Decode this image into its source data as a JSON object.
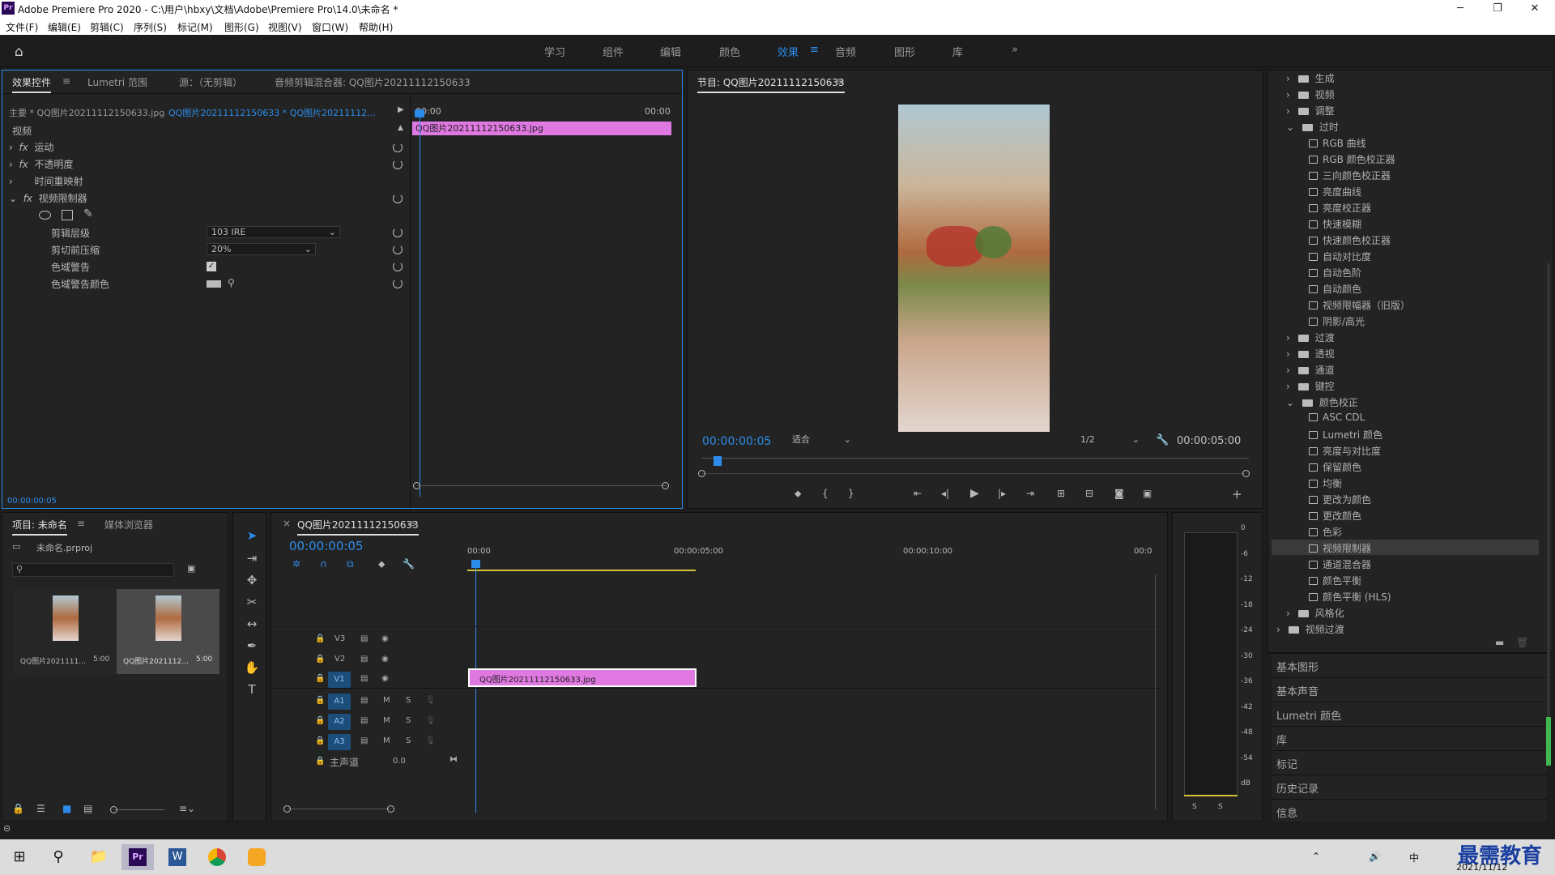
{
  "window": {
    "title": "Adobe Premiere Pro 2020 - C:\\用户\\hbxy\\文档\\Adobe\\Premiere Pro\\14.0\\未命名 *",
    "app_badge": "Pr"
  },
  "menu": [
    "文件(F)",
    "编辑(E)",
    "剪辑(C)",
    "序列(S)",
    "标记(M)",
    "图形(G)",
    "视图(V)",
    "窗口(W)",
    "帮助(H)"
  ],
  "workspaces": [
    "学习",
    "组件",
    "编辑",
    "颜色",
    "效果",
    "音频",
    "图形",
    "库"
  ],
  "effect_controls": {
    "tabs": [
      "效果控件",
      "Lumetri 范围",
      "源：（无剪辑）",
      "音频剪辑混合器: QQ图片20211112150633"
    ],
    "master": "主要 * QQ图片20211112150633.jpg",
    "sequence_clip": "QQ图片20211112150633 * QQ图片20211112...",
    "time_start": "00:00",
    "time_end": "00:00",
    "clip_name": "QQ图片20211112150633.jpg",
    "section": "视频",
    "effects": [
      "运动",
      "不透明度",
      "时间重映射",
      "视频限制器"
    ],
    "params": [
      {
        "label": "剪辑层级",
        "value": "103 IRE"
      },
      {
        "label": "剪切前压缩",
        "value": "20%"
      },
      {
        "label": "色域警告",
        "value": ""
      },
      {
        "label": "色域警告颜色",
        "value": ""
      }
    ],
    "timecode": "00:00:00:05"
  },
  "program": {
    "title": "节目: QQ图片20211112150633",
    "timecode": "00:00:00:05",
    "fit": "适合",
    "resolution": "1/2",
    "duration": "00:00:05:00"
  },
  "project": {
    "tabs": [
      "项目: 未命名",
      "媒体浏览器"
    ],
    "file": "未命名.prproj",
    "items": [
      {
        "name": "QQ图片2021111...",
        "dur": "5:00"
      },
      {
        "name": "QQ图片2021112...",
        "dur": "5:00"
      }
    ]
  },
  "timeline": {
    "title": "QQ图片20211112150633",
    "timecode": "00:00:00:05",
    "ruler": [
      "00:00",
      "00:00:05:00",
      "00:00:10:00",
      "00:0"
    ],
    "video_tracks": [
      "V3",
      "V2",
      "V1"
    ],
    "audio_tracks": [
      "A1",
      "A2",
      "A3"
    ],
    "master_label": "主声道",
    "master_value": "0.0",
    "clip": "QQ图片20211112150633.jpg",
    "m": "M",
    "s": "S"
  },
  "meter": {
    "scale": [
      "0",
      "-6",
      "-12",
      "-18",
      "-24",
      "-30",
      "-36",
      "-42",
      "-48",
      "-54",
      "dB"
    ],
    "solo": [
      "S",
      "S"
    ]
  },
  "effects_panel": {
    "tree": [
      {
        "label": "生成",
        "type": "folder",
        "indent": 0
      },
      {
        "label": "视频",
        "type": "folder",
        "indent": 0
      },
      {
        "label": "调整",
        "type": "folder",
        "indent": 0
      },
      {
        "label": "过时",
        "type": "folder",
        "indent": 0,
        "open": true
      },
      {
        "label": "RGB 曲线",
        "type": "fx",
        "indent": 1
      },
      {
        "label": "RGB 颜色校正器",
        "type": "fx",
        "indent": 1
      },
      {
        "label": "三向颜色校正器",
        "type": "fx",
        "indent": 1
      },
      {
        "label": "亮度曲线",
        "type": "fx",
        "indent": 1
      },
      {
        "label": "亮度校正器",
        "type": "fx",
        "indent": 1
      },
      {
        "label": "快速模糊",
        "type": "fx",
        "indent": 1
      },
      {
        "label": "快速颜色校正器",
        "type": "fx",
        "indent": 1
      },
      {
        "label": "自动对比度",
        "type": "fx",
        "indent": 1
      },
      {
        "label": "自动色阶",
        "type": "fx",
        "indent": 1
      },
      {
        "label": "自动颜色",
        "type": "fx",
        "indent": 1
      },
      {
        "label": "视频限幅器（旧版）",
        "type": "fx",
        "indent": 1
      },
      {
        "label": "阴影/高光",
        "type": "fx",
        "indent": 1
      },
      {
        "label": "过渡",
        "type": "folder",
        "indent": 0
      },
      {
        "label": "透视",
        "type": "folder",
        "indent": 0
      },
      {
        "label": "通道",
        "type": "folder",
        "indent": 0
      },
      {
        "label": "键控",
        "type": "folder",
        "indent": 0
      },
      {
        "label": "颜色校正",
        "type": "folder",
        "indent": 0,
        "open": true
      },
      {
        "label": "ASC CDL",
        "type": "fx",
        "indent": 1
      },
      {
        "label": "Lumetri 颜色",
        "type": "fx",
        "indent": 1
      },
      {
        "label": "亮度与对比度",
        "type": "fx",
        "indent": 1
      },
      {
        "label": "保留颜色",
        "type": "fx",
        "indent": 1
      },
      {
        "label": "均衡",
        "type": "fx",
        "indent": 1
      },
      {
        "label": "更改为颜色",
        "type": "fx",
        "indent": 1
      },
      {
        "label": "更改颜色",
        "type": "fx",
        "indent": 1
      },
      {
        "label": "色彩",
        "type": "fx",
        "indent": 1
      },
      {
        "label": "视频限制器",
        "type": "fx",
        "indent": 1,
        "selected": true
      },
      {
        "label": "通道混合器",
        "type": "fx",
        "indent": 1
      },
      {
        "label": "颜色平衡",
        "type": "fx",
        "indent": 1
      },
      {
        "label": "颜色平衡 (HLS)",
        "type": "fx",
        "indent": 1
      },
      {
        "label": "风格化",
        "type": "folder",
        "indent": 0
      },
      {
        "label": "视频过渡",
        "type": "folder",
        "indent": -1
      }
    ],
    "panels": [
      "基本图形",
      "基本声音",
      "Lumetri 颜色",
      "库",
      "标记",
      "历史记录",
      "信息"
    ]
  },
  "taskbar": {
    "time": "2021/11/12",
    "watermark": "最需教育",
    "ime": "中"
  }
}
